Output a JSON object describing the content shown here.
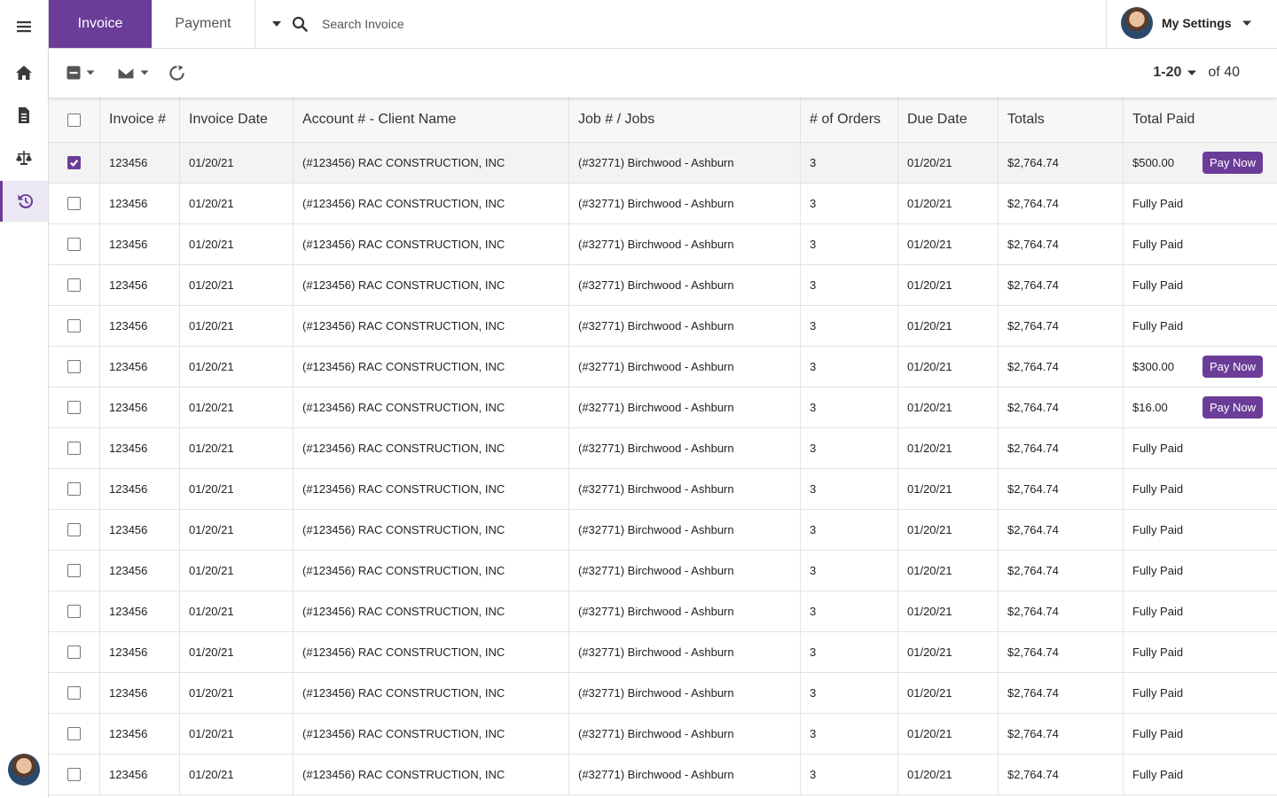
{
  "nav": {
    "items": [
      {
        "icon": "menu-icon"
      },
      {
        "icon": "home-icon"
      },
      {
        "icon": "document-icon"
      },
      {
        "icon": "scale-icon"
      },
      {
        "icon": "history-icon",
        "active": true
      }
    ]
  },
  "tabs": {
    "invoice": "Invoice",
    "payment": "Payment"
  },
  "search": {
    "placeholder": "Search Invoice"
  },
  "user": {
    "settings_label": "My Settings"
  },
  "pager": {
    "range": "1-20",
    "total": "of 40"
  },
  "table": {
    "headers": {
      "invoice": "Invoice #",
      "invoice_date": "Invoice Date",
      "account": "Account # - Client Name",
      "job": "Job # / Jobs",
      "orders": "# of Orders",
      "due": "Due Date",
      "totals": "Totals",
      "paid": "Total Paid"
    },
    "pay_button": "Pay Now",
    "rows": [
      {
        "checked": true,
        "invoice": "123456",
        "date": "01/20/21",
        "account": "(#123456) RAC CONSTRUCTION, INC",
        "job": "(#32771) Birchwood - Ashburn",
        "orders": "3",
        "due": "01/20/21",
        "total": "$2,764.74",
        "paid": "$500.00",
        "pay": true
      },
      {
        "checked": false,
        "invoice": "123456",
        "date": "01/20/21",
        "account": "(#123456) RAC CONSTRUCTION, INC",
        "job": "(#32771) Birchwood - Ashburn",
        "orders": "3",
        "due": "01/20/21",
        "total": "$2,764.74",
        "paid": "Fully Paid",
        "pay": false
      },
      {
        "checked": false,
        "invoice": "123456",
        "date": "01/20/21",
        "account": "(#123456) RAC CONSTRUCTION, INC",
        "job": "(#32771) Birchwood - Ashburn",
        "orders": "3",
        "due": "01/20/21",
        "total": "$2,764.74",
        "paid": "Fully Paid",
        "pay": false
      },
      {
        "checked": false,
        "invoice": "123456",
        "date": "01/20/21",
        "account": "(#123456) RAC CONSTRUCTION, INC",
        "job": "(#32771) Birchwood - Ashburn",
        "orders": "3",
        "due": "01/20/21",
        "total": "$2,764.74",
        "paid": "Fully Paid",
        "pay": false
      },
      {
        "checked": false,
        "invoice": "123456",
        "date": "01/20/21",
        "account": "(#123456) RAC CONSTRUCTION, INC",
        "job": "(#32771) Birchwood - Ashburn",
        "orders": "3",
        "due": "01/20/21",
        "total": "$2,764.74",
        "paid": "Fully Paid",
        "pay": false
      },
      {
        "checked": false,
        "invoice": "123456",
        "date": "01/20/21",
        "account": "(#123456) RAC CONSTRUCTION, INC",
        "job": "(#32771) Birchwood - Ashburn",
        "orders": "3",
        "due": "01/20/21",
        "total": "$2,764.74",
        "paid": "$300.00",
        "pay": true
      },
      {
        "checked": false,
        "invoice": "123456",
        "date": "01/20/21",
        "account": "(#123456) RAC CONSTRUCTION, INC",
        "job": "(#32771) Birchwood - Ashburn",
        "orders": "3",
        "due": "01/20/21",
        "total": "$2,764.74",
        "paid": "$16.00",
        "pay": true
      },
      {
        "checked": false,
        "invoice": "123456",
        "date": "01/20/21",
        "account": "(#123456) RAC CONSTRUCTION, INC",
        "job": "(#32771) Birchwood - Ashburn",
        "orders": "3",
        "due": "01/20/21",
        "total": "$2,764.74",
        "paid": "Fully Paid",
        "pay": false
      },
      {
        "checked": false,
        "invoice": "123456",
        "date": "01/20/21",
        "account": "(#123456) RAC CONSTRUCTION, INC",
        "job": "(#32771) Birchwood - Ashburn",
        "orders": "3",
        "due": "01/20/21",
        "total": "$2,764.74",
        "paid": "Fully Paid",
        "pay": false
      },
      {
        "checked": false,
        "invoice": "123456",
        "date": "01/20/21",
        "account": "(#123456) RAC CONSTRUCTION, INC",
        "job": "(#32771) Birchwood - Ashburn",
        "orders": "3",
        "due": "01/20/21",
        "total": "$2,764.74",
        "paid": "Fully Paid",
        "pay": false
      },
      {
        "checked": false,
        "invoice": "123456",
        "date": "01/20/21",
        "account": "(#123456) RAC CONSTRUCTION, INC",
        "job": "(#32771) Birchwood - Ashburn",
        "orders": "3",
        "due": "01/20/21",
        "total": "$2,764.74",
        "paid": "Fully Paid",
        "pay": false
      },
      {
        "checked": false,
        "invoice": "123456",
        "date": "01/20/21",
        "account": "(#123456) RAC CONSTRUCTION, INC",
        "job": "(#32771) Birchwood - Ashburn",
        "orders": "3",
        "due": "01/20/21",
        "total": "$2,764.74",
        "paid": "Fully Paid",
        "pay": false
      },
      {
        "checked": false,
        "invoice": "123456",
        "date": "01/20/21",
        "account": "(#123456) RAC CONSTRUCTION, INC",
        "job": "(#32771) Birchwood - Ashburn",
        "orders": "3",
        "due": "01/20/21",
        "total": "$2,764.74",
        "paid": "Fully Paid",
        "pay": false
      },
      {
        "checked": false,
        "invoice": "123456",
        "date": "01/20/21",
        "account": "(#123456) RAC CONSTRUCTION, INC",
        "job": "(#32771) Birchwood - Ashburn",
        "orders": "3",
        "due": "01/20/21",
        "total": "$2,764.74",
        "paid": "Fully Paid",
        "pay": false
      },
      {
        "checked": false,
        "invoice": "123456",
        "date": "01/20/21",
        "account": "(#123456) RAC CONSTRUCTION, INC",
        "job": "(#32771) Birchwood - Ashburn",
        "orders": "3",
        "due": "01/20/21",
        "total": "$2,764.74",
        "paid": "Fully Paid",
        "pay": false
      },
      {
        "checked": false,
        "invoice": "123456",
        "date": "01/20/21",
        "account": "(#123456) RAC CONSTRUCTION, INC",
        "job": "(#32771) Birchwood - Ashburn",
        "orders": "3",
        "due": "01/20/21",
        "total": "$2,764.74",
        "paid": "Fully Paid",
        "pay": false
      }
    ]
  },
  "colors": {
    "accent": "#6b3d98",
    "active_nav_bg": "#ece8f3"
  }
}
